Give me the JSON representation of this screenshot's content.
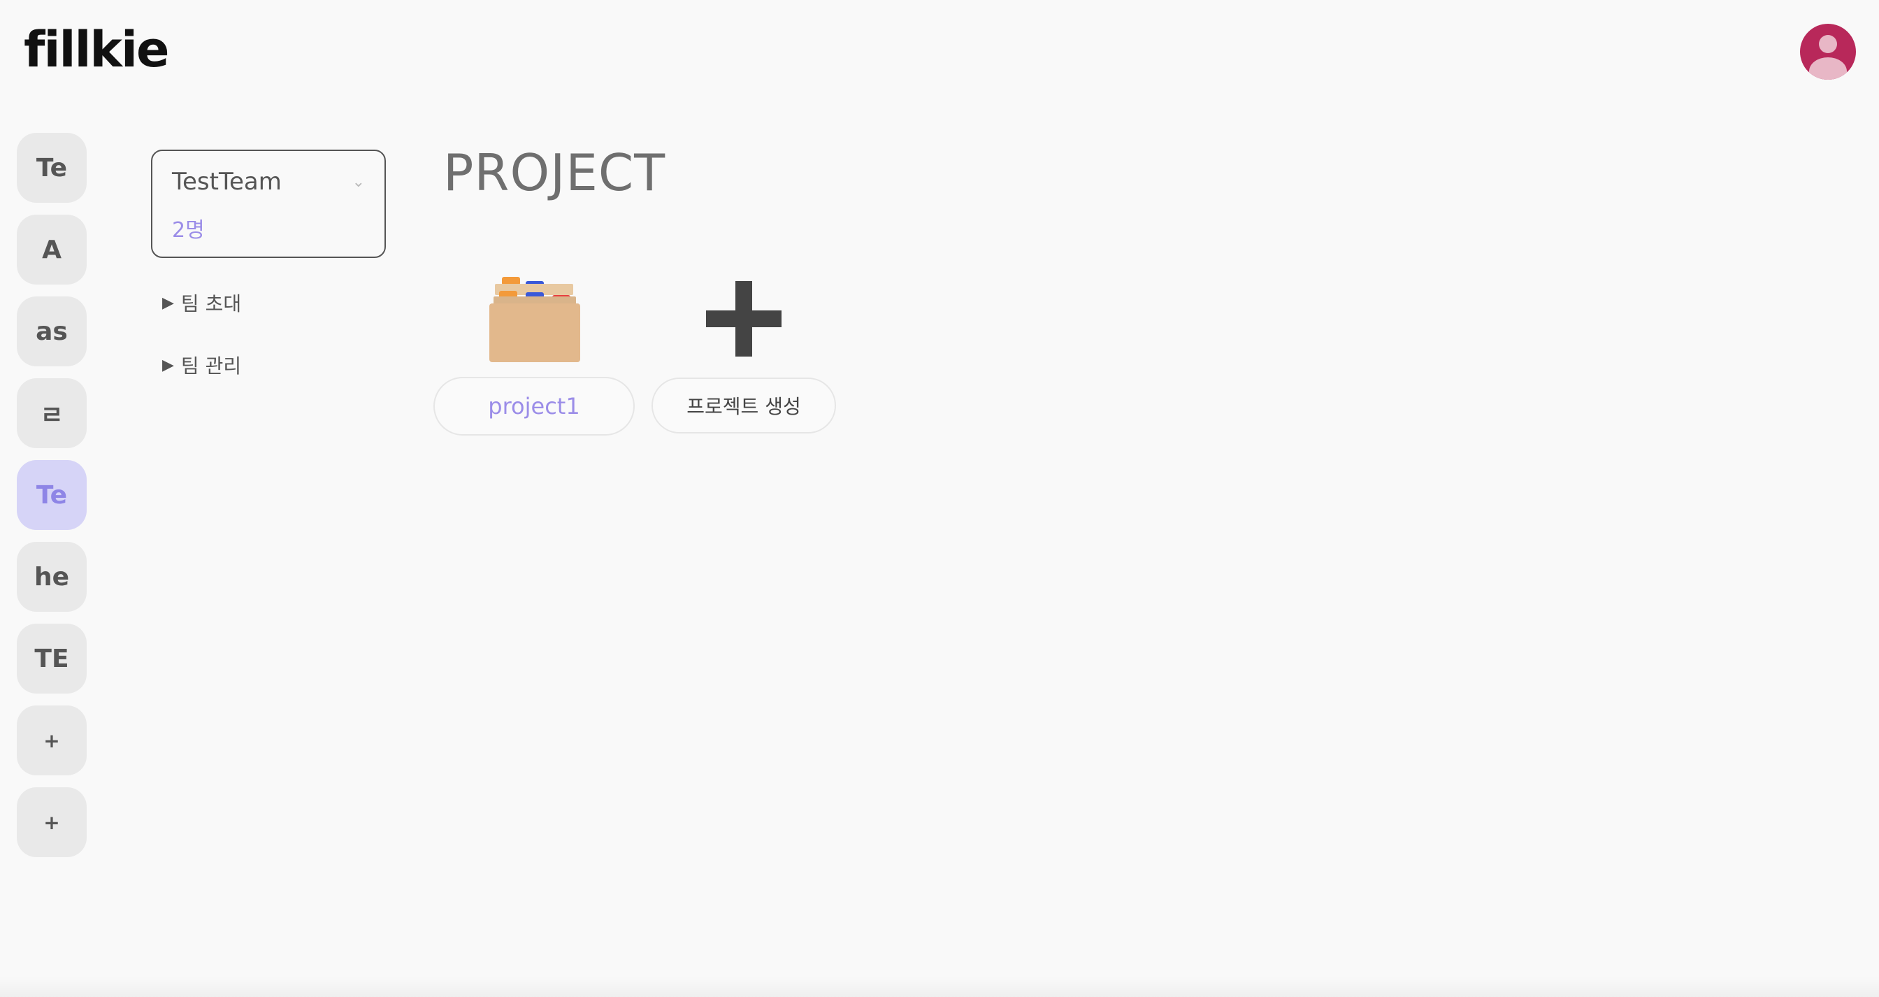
{
  "app": {
    "logo": "fillkie"
  },
  "rail": {
    "items": [
      {
        "label": "Te",
        "active": false
      },
      {
        "label": "A",
        "active": false
      },
      {
        "label": "as",
        "active": false
      },
      {
        "label": "ㄹ",
        "active": false
      },
      {
        "label": "Te",
        "active": true
      },
      {
        "label": "he",
        "active": false
      },
      {
        "label": "TE",
        "active": false
      },
      {
        "label": "+",
        "active": false
      },
      {
        "label": "+",
        "active": false
      }
    ]
  },
  "team": {
    "name": "TestTeam",
    "member_count": "2명",
    "chevron": "⌄"
  },
  "menu": {
    "invite": "팀 초대",
    "manage": "팀 관리",
    "arrow": "▶"
  },
  "main": {
    "title": "PROJECT",
    "projects": [
      {
        "name": "project1",
        "icon": "card-file-box-icon"
      }
    ],
    "create_label": "프로젝트 생성",
    "create_icon": "plus-icon"
  },
  "colors": {
    "accent": "#9b8de8",
    "active_rail_bg": "#d6d4f7",
    "avatar_bg": "#b8285a"
  }
}
